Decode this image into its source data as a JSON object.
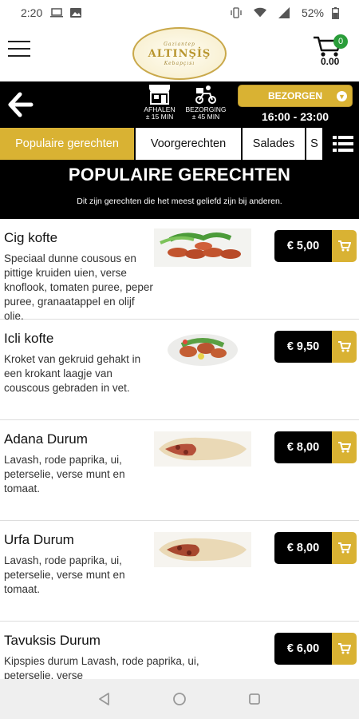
{
  "status_bar": {
    "time": "2:20",
    "battery": "52%"
  },
  "header": {
    "logo_top": "Gaziantep",
    "logo_name": "ALTINŞİŞ",
    "logo_bottom": "Kebapçısı",
    "cart_count": "0",
    "cart_total": "0.00"
  },
  "delivery": {
    "pickup_label": "AFHALEN",
    "pickup_time": "± 15 MIN",
    "delivery_label": "BEZORGING",
    "delivery_time": "± 45 MIN",
    "mode_select": "BEZORGEN",
    "hours": "16:00 - 23:00"
  },
  "tabs": [
    {
      "label": "Populaire gerechten",
      "active": true
    },
    {
      "label": "Voorgerechten",
      "active": false
    },
    {
      "label": "Salades",
      "active": false
    },
    {
      "label": "S",
      "active": false
    }
  ],
  "section": {
    "title": "POPULAIRE GERECHTEN",
    "subtitle": "Dit zijn gerechten die het meest geliefd zijn bij anderen."
  },
  "products": [
    {
      "name": "Cig kofte",
      "description": "Speciaal dunne cousous en pittige kruiden uien, verse knoflook, tomaten puree, peper puree, granaatappel en olijf olie.",
      "price": "€ 5,00"
    },
    {
      "name": "Icli kofte",
      "description": "Kroket van gekruid gehakt in een krokant laagje van couscous gebraden in vet.",
      "price": "€ 9,50"
    },
    {
      "name": "Adana Durum",
      "description": "Lavash, rode paprika, ui, peterselie, verse munt en tomaat.",
      "price": "€ 8,00"
    },
    {
      "name": "Urfa Durum",
      "description": "Lavash, rode paprika, ui, peterselie, verse munt en tomaat.",
      "price": "€ 8,00"
    },
    {
      "name": "Tavuksis Durum",
      "description": "Kipspies durum Lavash, rode paprika, ui, peterselie, verse",
      "price": "€ 6,00"
    }
  ],
  "colors": {
    "accent": "#d9b233",
    "dark": "#000000",
    "badge": "#2a9d3a"
  }
}
